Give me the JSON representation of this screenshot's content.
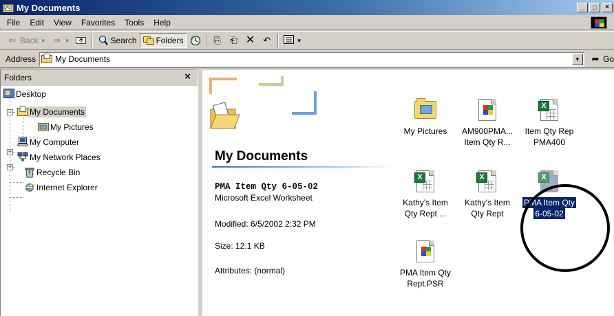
{
  "window": {
    "title": "My Documents",
    "caption_buttons": [
      "_",
      "□",
      "×"
    ],
    "title_icon": "folder-window-icon"
  },
  "menu": {
    "items": [
      "File",
      "Edit",
      "View",
      "Favorites",
      "Tools",
      "Help"
    ]
  },
  "toolbar": {
    "back": "Back",
    "search": "Search",
    "folders": "Folders"
  },
  "address": {
    "label": "Address",
    "value": "My Documents",
    "go": "Go"
  },
  "folders_pane": {
    "header": "Folders",
    "close": "×",
    "tree": [
      {
        "label": "Desktop",
        "icon": "desktop-icon"
      },
      {
        "label": "My Documents",
        "icon": "my-documents-icon",
        "selected": true
      },
      {
        "label": "My Pictures",
        "icon": "my-pictures-icon"
      },
      {
        "label": "My Computer",
        "icon": "my-computer-icon"
      },
      {
        "label": "My Network Places",
        "icon": "network-icon"
      },
      {
        "label": "Recycle Bin",
        "icon": "recycle-bin-icon"
      },
      {
        "label": "Internet Explorer",
        "icon": "ie-icon"
      }
    ]
  },
  "content": {
    "heading": "My Documents",
    "selected_file": {
      "name": "PMA Item Qty 6-05-02",
      "type": "Microsoft Excel Worksheet",
      "modified": "Modified: 6/5/2002 2:32 PM",
      "size": "Size: 12.1 KB",
      "attributes": "Attributes: (normal)"
    },
    "files": [
      {
        "line1": "My Pictures",
        "line2": "",
        "kind": "folder"
      },
      {
        "line1": "AM900PMA...",
        "line2": "Item Qty R...",
        "kind": "crystal"
      },
      {
        "line1": "Item Qty Rep",
        "line2": "PMA400",
        "kind": "excel"
      },
      {
        "line1": "Kathy's Item",
        "line2": "Qty Rept ...",
        "kind": "excel"
      },
      {
        "line1": "Kathy's Item",
        "line2": "Qty Rept",
        "kind": "excel"
      },
      {
        "line1": "PMA Item Qty",
        "line2": "6-05-02",
        "kind": "excel",
        "selected": true
      },
      {
        "line1": "PMA Item Qty",
        "line2": "Rept.PSR",
        "kind": "crystal"
      }
    ]
  },
  "colors": {
    "title_start": "#0a246a",
    "title_end": "#a6caf0",
    "selection": "#0a246a",
    "chrome": "#d4d0c8"
  }
}
